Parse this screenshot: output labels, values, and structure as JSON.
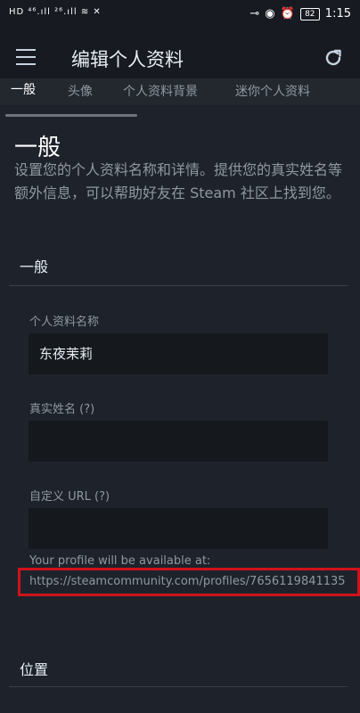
{
  "status_bar": {
    "left": "HD ⁴⁶.ıll ²⁶.ıll ≋ ✕",
    "battery": "82",
    "time": "1:15"
  },
  "app_bar": {
    "title": "编辑个人资料",
    "menu_icon": "hamburger-icon",
    "refresh_icon": "refresh-icon"
  },
  "tabs": [
    {
      "label": "一般"
    },
    {
      "label": "头像"
    },
    {
      "label": "个人资料背景"
    },
    {
      "label": "迷你个人资料"
    }
  ],
  "section": {
    "title": "一般",
    "description": "设置您的个人资料名称和详情。提供您的真实姓名等额外信息，可以帮助好友在 Steam 社区上找到您。"
  },
  "general_group": {
    "title": "一般"
  },
  "fields": {
    "profile_name": {
      "label": "个人资料名称",
      "value": "东夜茉莉"
    },
    "real_name": {
      "label": "真实姓名 (?)",
      "value": ""
    },
    "custom_url": {
      "label": "自定义 URL (?)",
      "value": ""
    }
  },
  "profile_note": "Your profile will be available at:",
  "profile_url": "https://steamcommunity.com/profiles/7656119841135",
  "location_group": {
    "title": "位置"
  },
  "colors": {
    "background": "#1e232b",
    "app_bar": "#171a21",
    "input_bg": "#15181d",
    "highlight": "#d0121b"
  }
}
